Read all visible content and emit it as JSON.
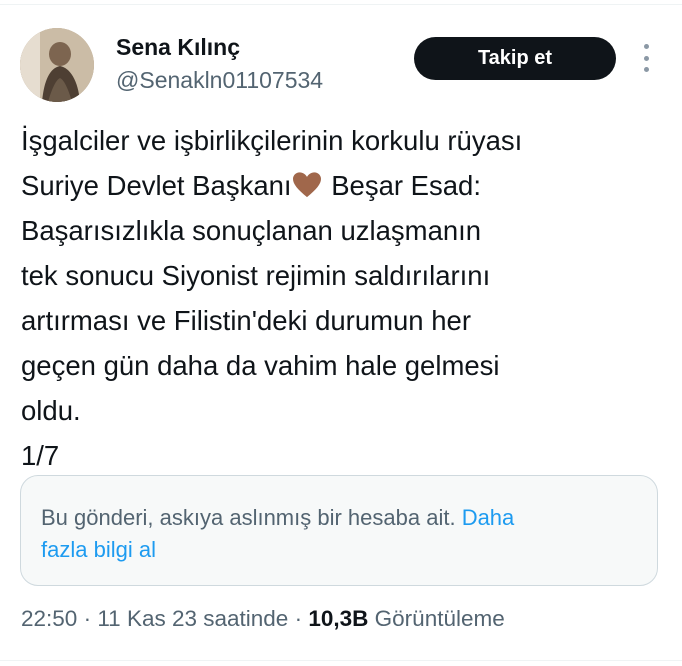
{
  "author": {
    "display_name": "Sena Kılınç",
    "handle": "@Senakln01107534",
    "avatar_icon": "profile-photo"
  },
  "header": {
    "follow_label": "Takip et",
    "more_icon": "more-vertical-icon"
  },
  "tweet": {
    "lines": [
      "İşgalciler ve işbirlikçilerinin korkulu rüyası",
      "Suriye Devlet Başkanı",
      "Beşar Esad:",
      "Başarısızlıkla sonuçlanan uzlaşmanın",
      "tek sonucu Siyonist rejimin saldırılarını",
      "artırması ve Filistin'deki durumun her",
      "geçen gün daha da vahim hale gelmesi",
      "oldu.",
      "1/7"
    ],
    "emoji": "brown-heart-icon",
    "emoji_color": "#a0674b"
  },
  "notice": {
    "text_line1": "Bu gönderi, askıya aslınmış bir hesaba ait.",
    "link_line1": "Daha",
    "link_line2": "fazla bilgi al"
  },
  "meta": {
    "time": "22:50",
    "date": "11 Kas 23 saatinde",
    "separator": "·",
    "views_count": "10,3B",
    "views_label": "Görüntüleme"
  },
  "colors": {
    "text_primary": "#0f1419",
    "text_secondary": "#536471",
    "link": "#1d9bf0",
    "button_bg": "#0f1419"
  }
}
